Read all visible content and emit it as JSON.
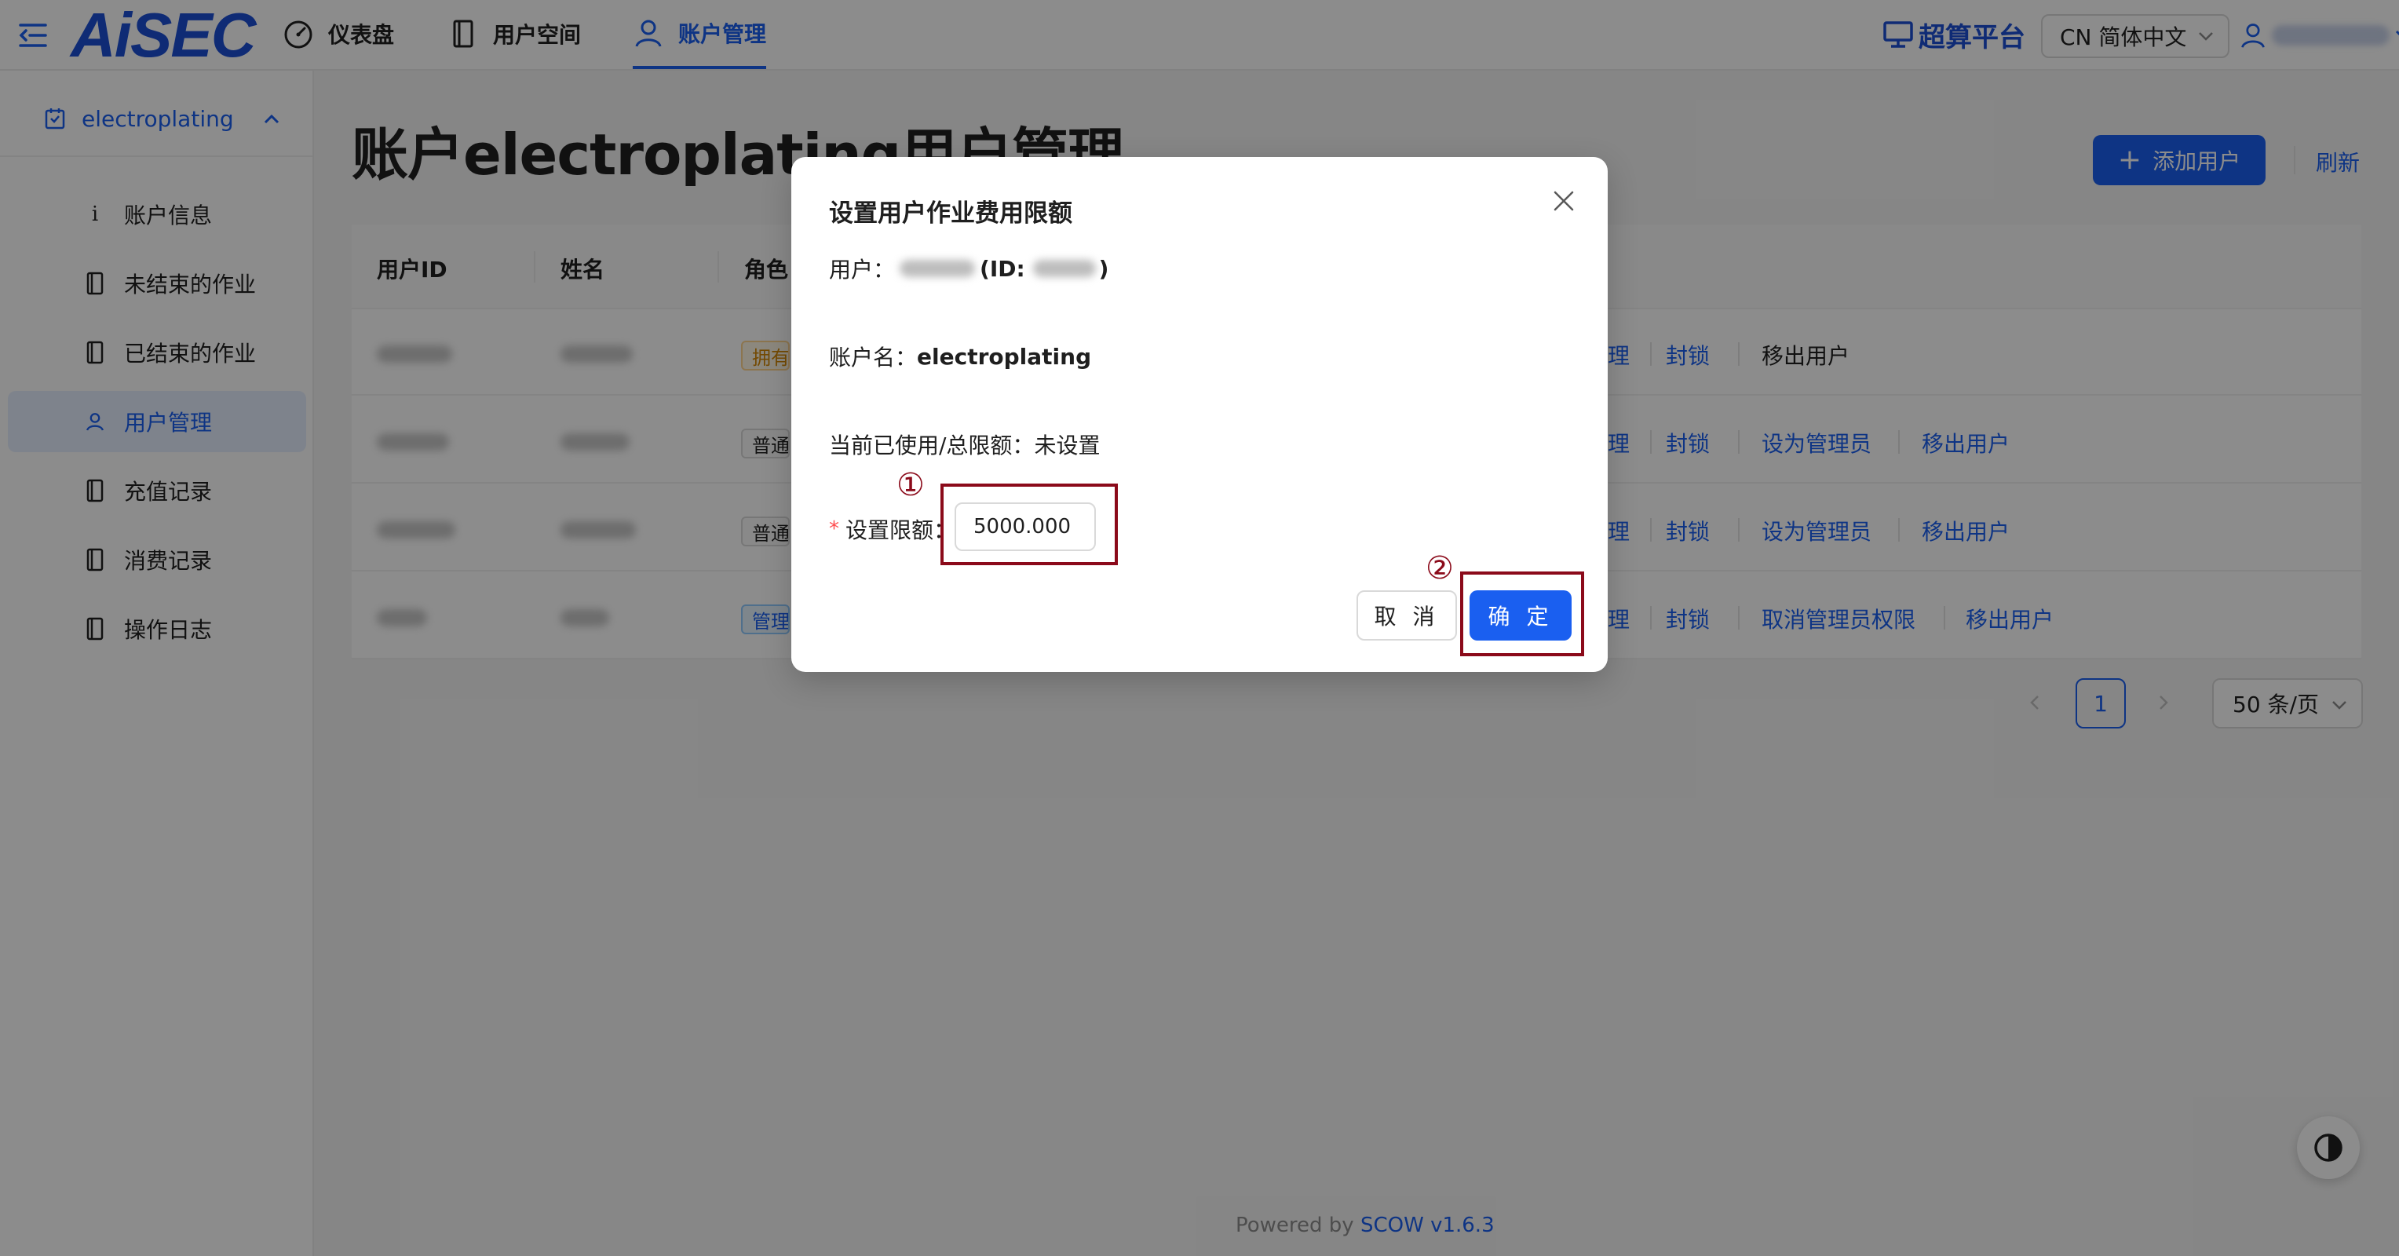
{
  "header": {
    "logo": "AiSEC",
    "nav": [
      {
        "label": "仪表盘",
        "icon": "dashboard-icon"
      },
      {
        "label": "用户空间",
        "icon": "book-icon"
      },
      {
        "label": "账户管理",
        "icon": "user-icon",
        "active": true
      }
    ],
    "platform": "超算平台",
    "language": "CN 简体中文"
  },
  "sidebar": {
    "account": "electroplating",
    "items": [
      {
        "label": "账户信息",
        "icon": "info-icon"
      },
      {
        "label": "未结束的作业",
        "icon": "book-icon"
      },
      {
        "label": "已结束的作业",
        "icon": "book-icon"
      },
      {
        "label": "用户管理",
        "icon": "user-icon",
        "active": true
      },
      {
        "label": "充值记录",
        "icon": "book-icon"
      },
      {
        "label": "消费记录",
        "icon": "book-icon"
      },
      {
        "label": "操作日志",
        "icon": "book-icon"
      }
    ]
  },
  "main": {
    "title": "账户electroplating用户管理",
    "add_user": "添加用户",
    "refresh": "刷新",
    "columns": [
      "用户ID",
      "姓名",
      "角色"
    ],
    "rows": [
      {
        "role": "拥有者",
        "actions": [
          "理",
          "封锁",
          "移出用户"
        ]
      },
      {
        "role": "普通用户",
        "actions": [
          "理",
          "封锁",
          "设为管理员",
          "移出用户"
        ]
      },
      {
        "role": "普通用户",
        "actions": [
          "理",
          "封锁",
          "设为管理员",
          "移出用户"
        ]
      },
      {
        "role": "管理员",
        "actions": [
          "理",
          "封锁",
          "取消管理员权限",
          "移出用户"
        ]
      }
    ],
    "pagination": {
      "current": "1",
      "page_size": "50 条/页"
    }
  },
  "footer": {
    "prefix": "Powered by ",
    "link": "SCOW v1.6.3"
  },
  "modal": {
    "title": "设置用户作业费用限额",
    "user_label": "用户：",
    "user_id_prefix": "(ID:",
    "user_id_suffix": ")",
    "account_label": "账户名：",
    "account_value": "electroplating",
    "usage_label": "当前已使用/总限额：",
    "usage_value": "未设置",
    "required_mark": "*",
    "limit_label": "设置限额：",
    "limit_value": "5000.000",
    "cancel": "取 消",
    "ok": "确 定"
  },
  "annotations": {
    "step1": "①",
    "step2": "②"
  },
  "colors": {
    "primary": "#1a5ff0",
    "annotation": "#8b0a1a",
    "mask": "rgba(0,0,0,0.45)"
  }
}
